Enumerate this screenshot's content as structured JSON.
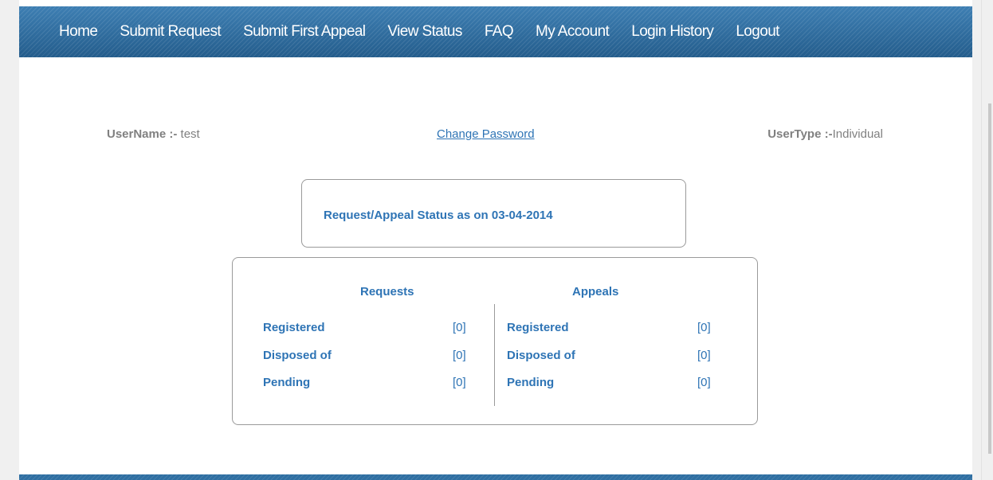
{
  "nav": {
    "items": [
      {
        "label": "Home"
      },
      {
        "label": "Submit Request"
      },
      {
        "label": "Submit First Appeal"
      },
      {
        "label": "View Status"
      },
      {
        "label": "FAQ"
      },
      {
        "label": "My Account"
      },
      {
        "label": "Login History"
      },
      {
        "label": "Logout"
      }
    ]
  },
  "user": {
    "name_label": "UserName :-",
    "name_value": "test",
    "change_password": "Change Password",
    "type_label": "UserType :-",
    "type_value": "Individual"
  },
  "status": {
    "title": "Request/Appeal Status as on 03-04-2014"
  },
  "requests": {
    "heading": "Requests",
    "rows": [
      {
        "label": "Registered",
        "value": "[0]"
      },
      {
        "label": "Disposed of",
        "value": "[0]"
      },
      {
        "label": "Pending",
        "value": "[0]"
      }
    ]
  },
  "appeals": {
    "heading": "Appeals",
    "rows": [
      {
        "label": "Registered",
        "value": "[0]"
      },
      {
        "label": "Disposed of",
        "value": "[0]"
      },
      {
        "label": "Pending",
        "value": "[0]"
      }
    ]
  },
  "colors": {
    "nav_bg": "#2f6fa2",
    "accent_text": "#2e74b5",
    "muted_text": "#808080"
  }
}
